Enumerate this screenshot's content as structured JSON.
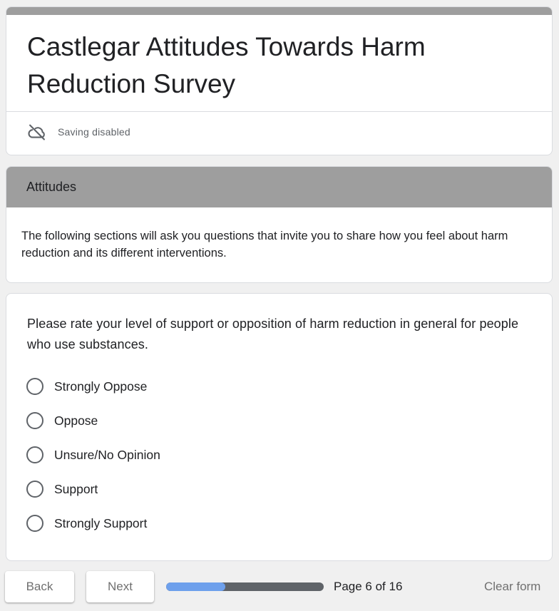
{
  "form": {
    "title": "Castlegar Attitudes Towards Harm Reduction Survey",
    "saving_status": "Saving disabled",
    "saving_icon": "cloud-off-icon"
  },
  "section": {
    "title": "Attitudes",
    "description": "The following sections will ask you questions that invite you to share how you feel about harm reduction and its different interventions."
  },
  "question": {
    "text": "Please rate your level of support or opposition of harm reduction in general for people who use substances.",
    "options": [
      "Strongly Oppose",
      "Oppose",
      "Unsure/No Opinion",
      "Support",
      "Strongly Support"
    ],
    "selected": null
  },
  "footer": {
    "back_label": "Back",
    "next_label": "Next",
    "page_indicator": "Page 6 of 16",
    "progress_fraction": 0.375,
    "clear_label": "Clear form"
  },
  "colors": {
    "accent_gray": "#9e9e9e",
    "progress_fill": "#6ea0ec",
    "progress_track": "#5f6368",
    "background": "#f0f0f0"
  }
}
